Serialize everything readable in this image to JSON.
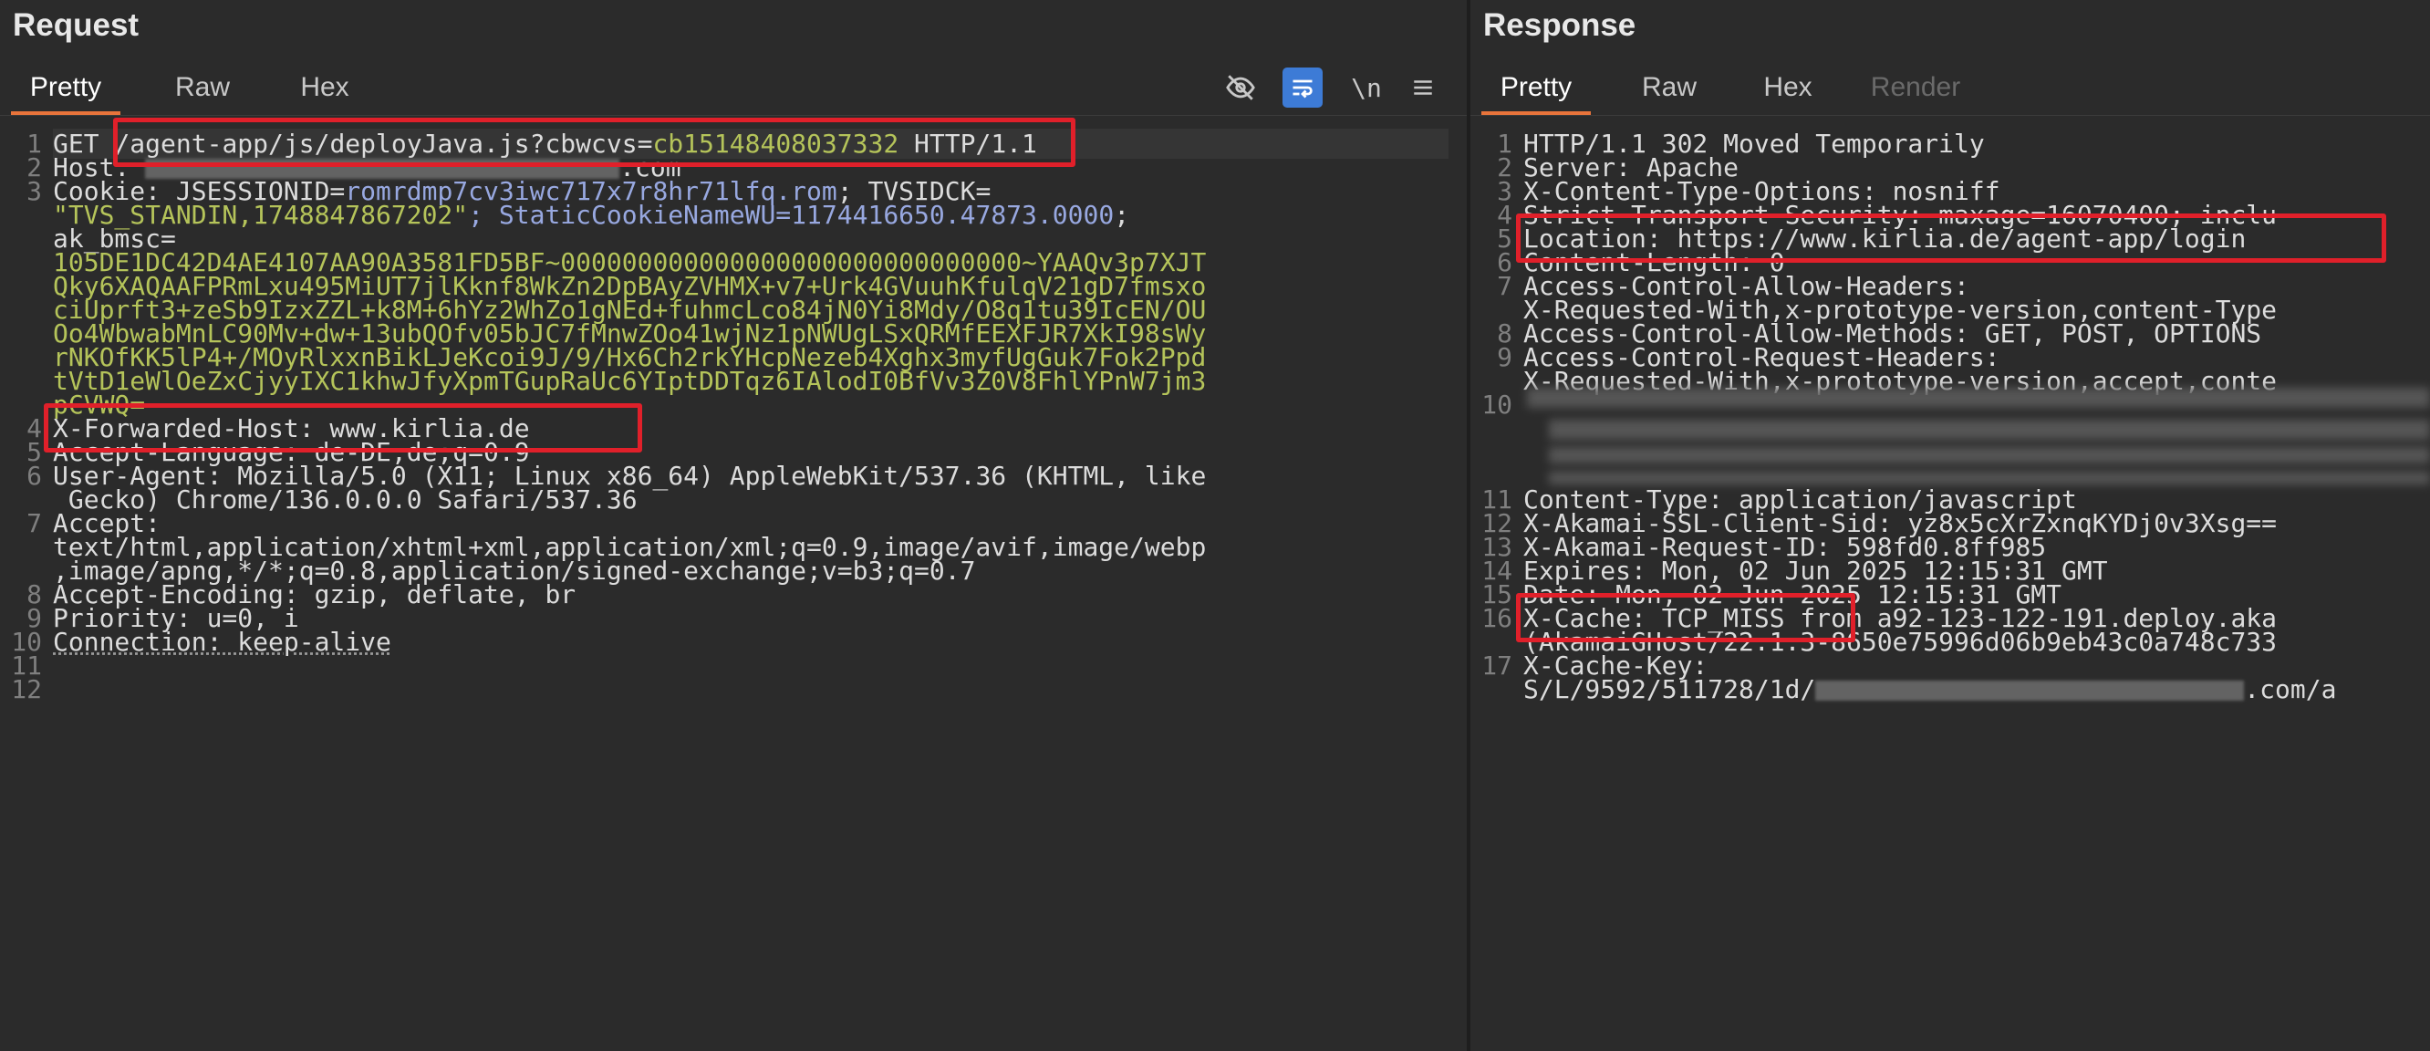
{
  "request": {
    "title": "Request",
    "tabs": [
      "Pretty",
      "Raw",
      "Hex"
    ],
    "toolbar": {
      "newline_label": "\\n"
    },
    "lines": [
      {
        "n": "1",
        "method": "GET ",
        "path": "/agent-app/js/deployJava.js?cbwcvs=",
        "param": "cb15148408037332",
        "proto": " HTTP/1.1"
      },
      {
        "n": "2",
        "key": "Host:",
        "suffix": ".com"
      },
      {
        "n": "3",
        "a": "Cookie: JSESSIONID=",
        "b": "romrdmp7cv3iwc717x7r8hr71lfq.rom",
        "c": "; TVSIDCK=",
        "d": "\"TVS_STANDIN,1748847867202\"",
        "e": "; StaticCookieNameWU=",
        "f": "1174416650.47873.0000",
        "g": ";",
        "h": "ak_bmsc=",
        "blob": [
          "105DE1DC42D4AE4107AA90A3581FD5BF~000000000000000000000000000000~YAAQv3p7XJT",
          "Qky6XAQAAFPRmLxu495MiUT7jlKknf8WkZn2DpBAyZVHMX+v7+Urk4GVuuhKfulqV21gD7fmsxo",
          "ciUprft3+zeSb9IzxZZL+k8M+6hYz2WhZo1gNEd+fuhmcLco84jN0Yi8Mdy/O8q1tu39IcEN/OU",
          "Oo4WbwabMnLC90Mv+dw+13ubQOfv05bJC7fMnwZOo41wjNz1pNWUgLSxQRMfEEXFJR7XkI98sWy",
          "rNKOfKK5lP4+/MOyRlxxnBikLJeKcoi9J/9/Hx6Ch2rkYHcpNezeb4Xghx3myfUgGuk7Fok2Ppd",
          "tVtD1eWlOeZxCjyyIXC1khwJfyXpmTGupRaUc6YIptDDTqz6IAlodI0BfVv3Z0V8FhlYPnW7jm3",
          "pCVWQ="
        ]
      },
      {
        "n": "4",
        "text": "X-Forwarded-Host: www.kirlia.de"
      },
      {
        "n": "5",
        "text": "Accept-Language: de-DE,de;q=0.9"
      },
      {
        "n": "6",
        "text": "User-Agent: Mozilla/5.0 (X11; Linux x86_64) AppleWebKit/537.36 (KHTML, like",
        "cont": " Gecko) Chrome/136.0.0.0 Safari/537.36"
      },
      {
        "n": "7",
        "text": "Accept:",
        "cont": "text/html,application/xhtml+xml,application/xml;q=0.9,image/avif,image/webp",
        "cont2": ",image/apng,*/*;q=0.8,application/signed-exchange;v=b3;q=0.7"
      },
      {
        "n": "8",
        "text": "Accept-Encoding: gzip, deflate, br"
      },
      {
        "n": "9",
        "text": "Priority: u=0, i"
      },
      {
        "n": "10",
        "text": "Connection: keep-alive"
      },
      {
        "n": "11",
        "text": ""
      },
      {
        "n": "12",
        "text": ""
      }
    ]
  },
  "response": {
    "title": "Response",
    "tabs": [
      "Pretty",
      "Raw",
      "Hex",
      "Render"
    ],
    "lines": [
      {
        "n": "1",
        "text": "HTTP/1.1 302 Moved Temporarily"
      },
      {
        "n": "2",
        "text": "Server: Apache"
      },
      {
        "n": "3",
        "text": "X-Content-Type-Options: nosniff"
      },
      {
        "n": "4",
        "text": "Strict-Transport-Security: maxage=16070400; inclu"
      },
      {
        "n": "5",
        "text": "Location: https://www.kirlia.de/agent-app/login"
      },
      {
        "n": "6",
        "text": "Content-Length: 0"
      },
      {
        "n": "7",
        "text": "Access-Control-Allow-Headers:",
        "cont": "X-Requested-With,x-prototype-version,content-Type"
      },
      {
        "n": "8",
        "text": "Access-Control-Allow-Methods: GET, POST, OPTIONS"
      },
      {
        "n": "9",
        "text": "Access-Control-Request-Headers:",
        "cont": "X-Requested-With,x-prototype-version,accept,conte"
      },
      {
        "n": "10",
        "text": ""
      },
      {
        "n": "11",
        "text": "Content-Type: application/javascript"
      },
      {
        "n": "12",
        "text": "X-Akamai-SSL-Client-Sid: yz8x5cXrZxnqKYDj0v3Xsg=="
      },
      {
        "n": "13",
        "text": "X-Akamai-Request-ID: 598fd0.8ff985"
      },
      {
        "n": "14",
        "text": "Expires: Mon, 02 Jun 2025 12:15:31 GMT"
      },
      {
        "n": "15",
        "text": "Date: Mon, 02 Jun 2025 12:15:31 GMT"
      },
      {
        "n": "16",
        "text": "X-Cache: TCP_MISS from a92-123-122-191.deploy.aka",
        "cont": "(AkamaiGHost/22.1.3-8650e75996d06b9eb43c0a748c733"
      },
      {
        "n": "17",
        "text": "X-Cache-Key:",
        "cont_a": "S/L/9592/511728/1d/",
        "cont_b": ".com/a"
      }
    ]
  },
  "colors": {
    "highlight": "#e0202a",
    "accent_tab": "#e8743b",
    "value_green": "#b5c45a",
    "toggle_blue": "#3d7bd6"
  }
}
